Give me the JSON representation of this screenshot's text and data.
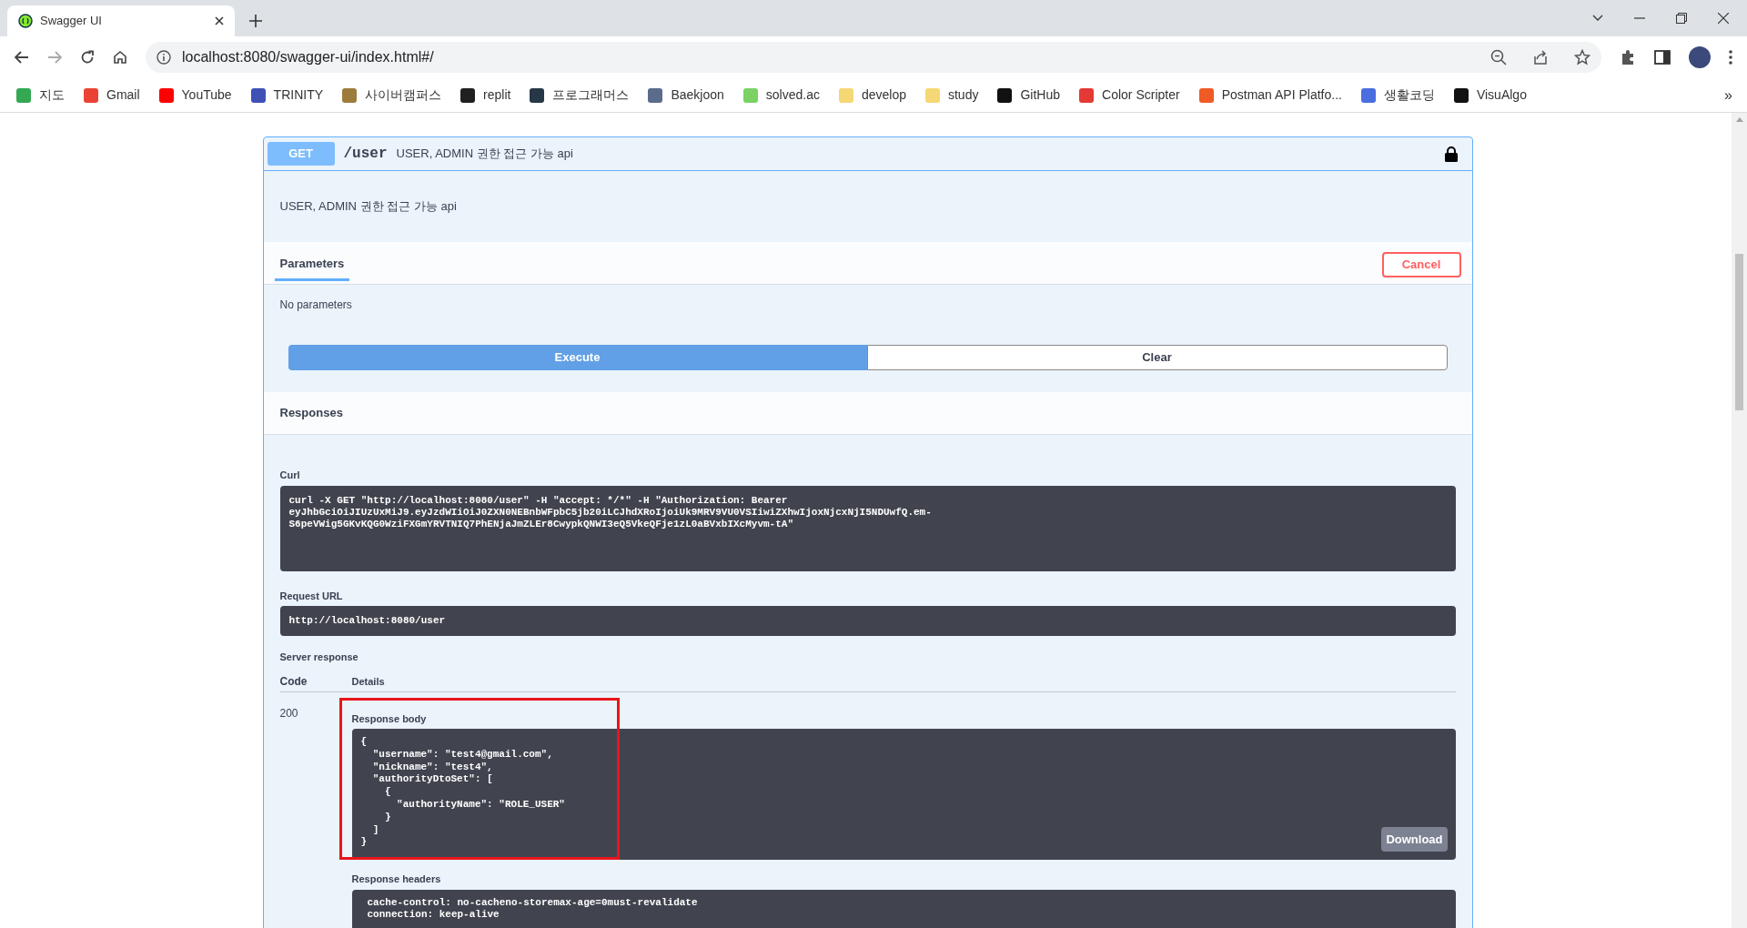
{
  "browser": {
    "tab": {
      "title": "Swagger UI"
    },
    "address": "localhost:8080/swagger-ui/index.html#/",
    "bookmarks": [
      {
        "label": "지도",
        "color": "#34a853"
      },
      {
        "label": "Gmail",
        "color": "#ea4335"
      },
      {
        "label": "YouTube",
        "color": "#ff0000"
      },
      {
        "label": "TRINITY",
        "color": "#3f51b5"
      },
      {
        "label": "사이버캠퍼스",
        "color": "#9c7c3c"
      },
      {
        "label": "replit",
        "color": "#202020"
      },
      {
        "label": "프로그래머스",
        "color": "#263747"
      },
      {
        "label": "Baekjoon",
        "color": "#5b6b8c"
      },
      {
        "label": "solved.ac",
        "color": "#7bd164"
      },
      {
        "label": "develop",
        "color": "#f6d775"
      },
      {
        "label": "study",
        "color": "#f6d775"
      },
      {
        "label": "GitHub",
        "color": "#111111"
      },
      {
        "label": "Color Scripter",
        "color": "#e53935"
      },
      {
        "label": "Postman API Platfo...",
        "color": "#ef5b25"
      },
      {
        "label": "생활코딩",
        "color": "#4a6ee0"
      },
      {
        "label": "VisuAlgo",
        "color": "#111111"
      }
    ],
    "more": "»"
  },
  "operation": {
    "method": "GET",
    "path": "/user",
    "summary": "USER, ADMIN 권한 접근 가능 api",
    "description": "USER, ADMIN 권한 접근 가능 api",
    "locked": true,
    "parameters": {
      "tab": "Parameters",
      "cancel": "Cancel",
      "empty": "No parameters"
    },
    "execute": "Execute",
    "clear": "Clear",
    "responses": {
      "title": "Responses",
      "curl_label": "Curl",
      "curl": "curl -X GET \"http://localhost:8080/user\" -H \"accept: */*\" -H \"Authorization: Bearer\neyJhbGciOiJIUzUxMiJ9.eyJzdWIiOiJ0ZXN0NEBnbWFpbC5jb20iLCJhdXRoIjoiUk9MRV9VU0VSIiwiZXhwIjoxNjcxNjI5NDUwfQ.em-\nS6peVWig5GKvKQG0WziFXGmYRVTNIQ7PhENjaJmZLEr8CwypkQNWI3eQ5VkeQFje1zL0aBVxbIXcMyvm-tA\"",
      "request_url_label": "Request URL",
      "request_url": "http://localhost:8080/user",
      "server_response": "Server response",
      "code_header": "Code",
      "details_header": "Details",
      "code": "200",
      "body_label": "Response body",
      "body": "{\n  \"username\": \"test4@gmail.com\",\n  \"nickname\": \"test4\",\n  \"authorityDtoSet\": [\n    {\n      \"authorityName\": \"ROLE_USER\"\n    }\n  ]\n}",
      "body_highlighted": true,
      "download": "Download",
      "headers_label": "Response headers",
      "headers": "cache-control: no-cacheno-storemax-age=0must-revalidate\nconnection: keep-alive"
    }
  }
}
